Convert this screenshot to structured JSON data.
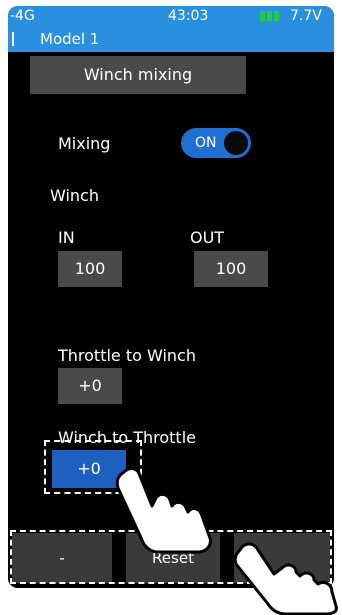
{
  "status": {
    "signal": "-4G",
    "time": "43:03",
    "voltage": "7.7V",
    "battery_color": "#22cc44"
  },
  "header": {
    "model": "Model 1"
  },
  "menu": {
    "title": "Winch mixing"
  },
  "mixing": {
    "label": "Mixing",
    "state": "ON"
  },
  "winch": {
    "label": "Winch",
    "in_label": "IN",
    "in_value": "100",
    "out_label": "OUT",
    "out_value": "100"
  },
  "throttle_to_winch": {
    "label": "Throttle to Winch",
    "value": "+0"
  },
  "winch_to_throttle": {
    "label": "Winch to Throttle",
    "value": "+0"
  },
  "bottom": {
    "left": "-",
    "center": "Reset",
    "right": ""
  },
  "colors": {
    "accent": "#2b8fe0",
    "selected": "#1f5fbf",
    "box": "#4a4a4a"
  }
}
